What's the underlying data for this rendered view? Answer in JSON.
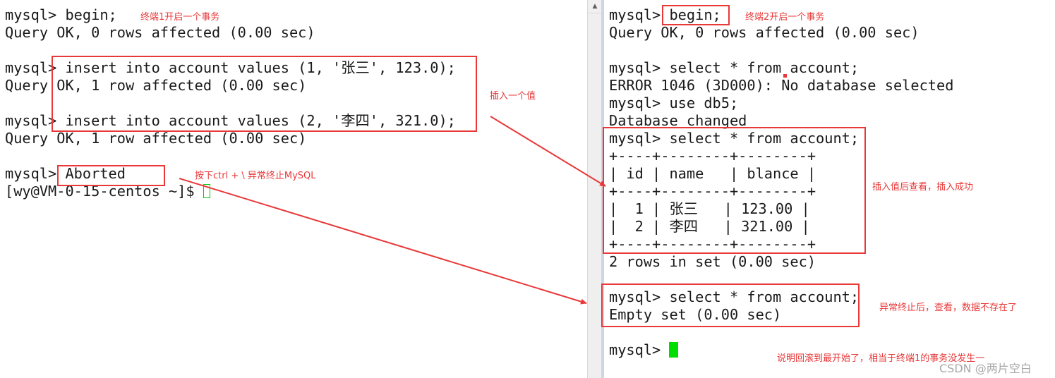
{
  "left_terminal": {
    "lines": [
      "mysql> begin;",
      "Query OK, 0 rows affected (0.00 sec)",
      "",
      "mysql> insert into account values (1, '张三', 123.0);",
      "Query OK, 1 row affected (0.00 sec)",
      "",
      "mysql> insert into account values (2, '李四', 321.0);",
      "Query OK, 1 row affected (0.00 sec)",
      "",
      "mysql> Aborted",
      "[wy@VM-0-15-centos ~]$ "
    ]
  },
  "right_terminal": {
    "lines": [
      "mysql> begin;",
      "Query OK, 0 rows affected (0.00 sec)",
      "",
      "mysql> select * from account;",
      "ERROR 1046 (3D000): No database selected",
      "mysql> use db5;",
      "Database changed",
      "mysql> select * from account;",
      "+----+--------+--------+",
      "| id | name   | blance |",
      "+----+--------+--------+",
      "|  1 | 张三   | 123.00 |",
      "|  2 | 李四   | 321.00 |",
      "+----+--------+--------+",
      "2 rows in set (0.00 sec)",
      "",
      "mysql> select * from account;",
      "Empty set (0.00 sec)",
      "",
      "mysql> "
    ]
  },
  "annotations": {
    "t1_begin": "终端1开启一个事务",
    "t2_begin": "终端2开启一个事务",
    "insert_value": "插入一个值",
    "ctrl_abort": "按下ctrl + \\ 异常终止MySQL",
    "query_success": "插入值后查看，插入成功",
    "after_abort": "异常终止后，查看，数据不存在了",
    "conclusion": "说明回滚到最开始了，相当于终端1的事务没发生一"
  },
  "watermark": "CSDN @两片空白",
  "colors": {
    "annotation": "#e83838",
    "cursor": "#00dd00",
    "text": "#1a1a1a"
  }
}
